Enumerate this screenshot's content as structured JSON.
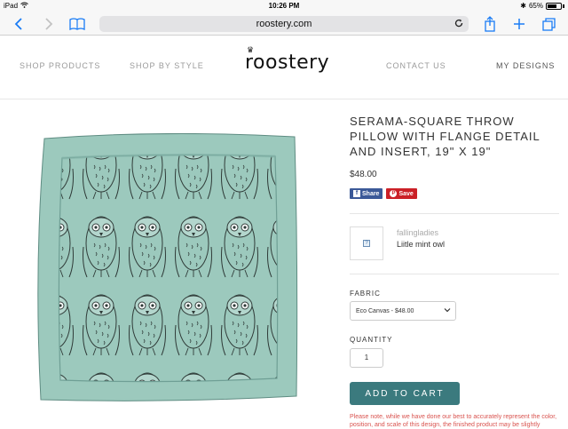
{
  "status_bar": {
    "device": "iPad",
    "time": "10:26 PM",
    "battery": "65%"
  },
  "browser": {
    "url": "roostery.com",
    "icons": {
      "back": "chevron-left-icon",
      "forward": "chevron-right-icon",
      "bookmarks": "book-icon",
      "reload": "reload-icon",
      "share": "share-icon",
      "new_tab": "plus-icon",
      "tabs": "tabs-icon"
    }
  },
  "nav": {
    "shop_products": "SHOP PRODUCTS",
    "shop_by_style": "SHOP BY STYLE",
    "logo": "roostery",
    "contact_us": "CONTACT US",
    "my_designs": "MY DESIGNS"
  },
  "product": {
    "title": "SERAMA-SQUARE THROW PILLOW WITH FLANGE DETAIL AND INSERT, 19\" X 19\"",
    "price": "$48.00",
    "share_label": "Share",
    "save_label": "Save",
    "designer": "fallingladies",
    "design_name": "Liitle mint owl",
    "fabric_label": "FABRIC",
    "fabric_selected": "Eco Canvas - $48.00",
    "quantity_label": "QUANTITY",
    "quantity_value": "1",
    "add_to_cart": "ADD TO CART",
    "note": "Please note, while we have done our best to accurately represent the color, position, and scale of this design, the finished product may be slightly"
  },
  "colors": {
    "pillow": "#9cc9bd",
    "accent_button": "#3b7a7e",
    "browser_blue": "#1a7cf5",
    "facebook": "#3b5998",
    "pinterest": "#cb2027",
    "note_red": "#d9534f"
  }
}
